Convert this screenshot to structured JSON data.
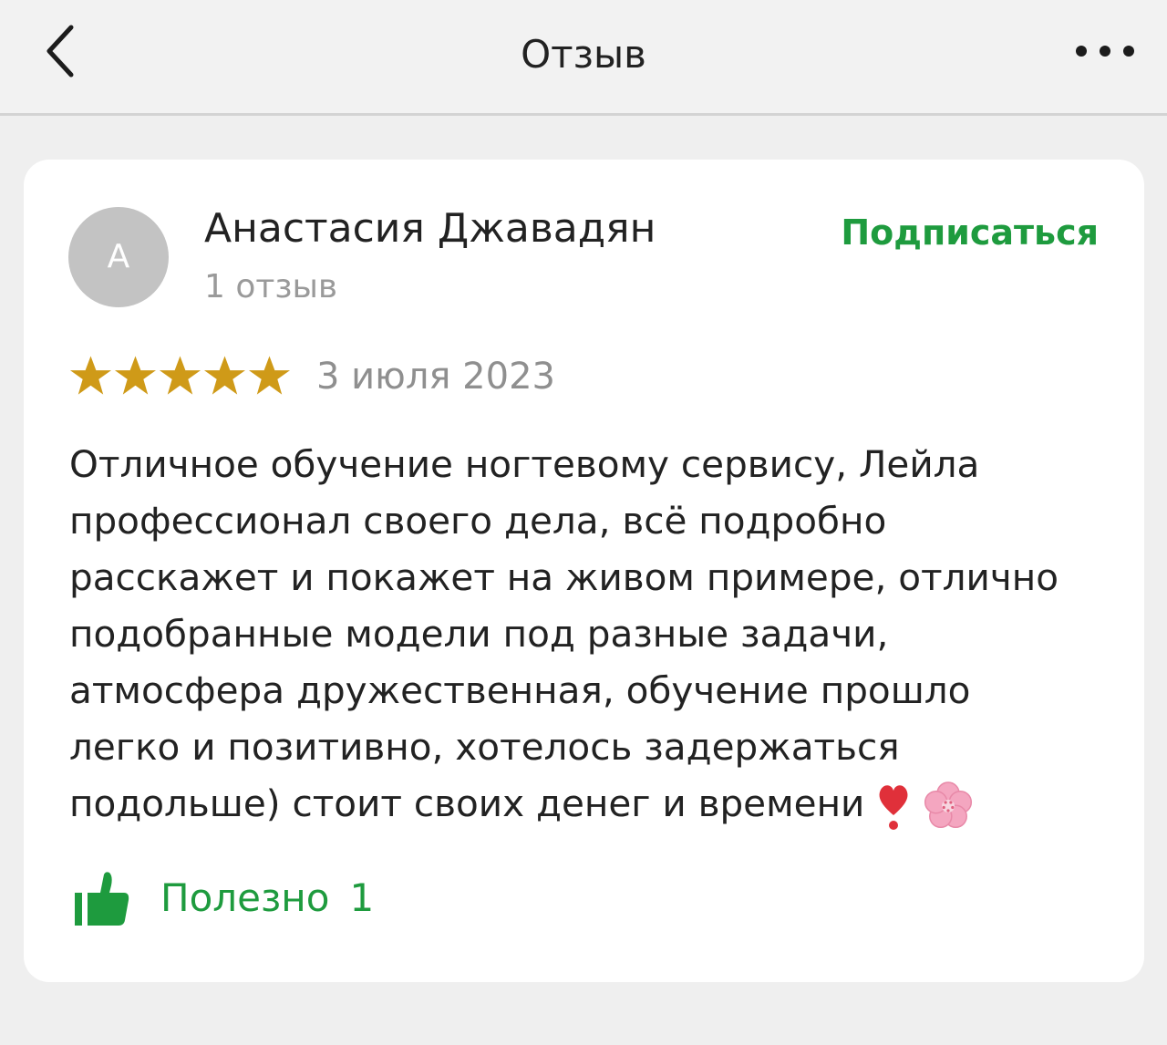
{
  "header": {
    "title": "Отзыв",
    "back_icon": "chevron-left-icon",
    "more_icon": "more-horizontal-icon"
  },
  "review": {
    "author": {
      "initial": "А",
      "name": "Анастасия Джавадян",
      "reviews_count": "1 отзыв"
    },
    "subscribe_label": "Подписаться",
    "rating": 5,
    "rating_max": 5,
    "date": "3 июля 2023",
    "text_lines": [
      "Отличное обучение ногтевому сервису, Лейла",
      "профессионал своего дела, всё подробно",
      "расскажет и покажет на живом примере, отлично",
      "подобранные модели под разные задачи,",
      "атмосфера дружественная, обучение прошло",
      "легко и позитивно, хотелось задержаться",
      "подольше) стоит своих денег и времени"
    ],
    "emojis": [
      "heavy-exclamation-heart-icon",
      "cherry-blossom-icon"
    ],
    "helpful_label": "Полезно",
    "helpful_count": "1",
    "helpful_icon": "thumbs-up-icon"
  },
  "colors": {
    "accent_green": "#1e9b3e",
    "star_gold": "#cf9a18",
    "heart_red": "#e0303a",
    "blossom_pink": "#f4a6c0"
  }
}
